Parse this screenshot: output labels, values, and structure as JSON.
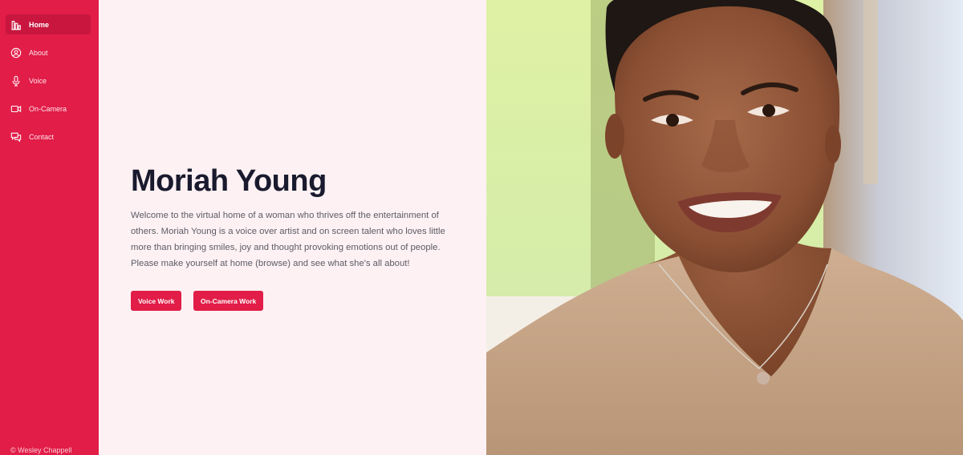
{
  "sidebar": {
    "items": [
      {
        "label": "Home",
        "icon": "home-chart-icon",
        "active": true
      },
      {
        "label": "About",
        "icon": "user-circle-icon",
        "active": false
      },
      {
        "label": "Voice",
        "icon": "microphone-icon",
        "active": false
      },
      {
        "label": "On-Camera",
        "icon": "video-camera-icon",
        "active": false
      },
      {
        "label": "Contact",
        "icon": "chat-bubbles-icon",
        "active": false
      }
    ],
    "footer": "© Wesley Chappell"
  },
  "main": {
    "title": "Moriah Young",
    "intro": "Welcome to the virtual home of a woman who thrives off the entertainment of others. Moriah Young is a voice over artist and on screen talent who loves little more than bringing smiles, joy and thought provoking emotions out of people. Please make yourself at home (browse) and see what she's all about!",
    "buttons": {
      "voice": "Voice Work",
      "camera": "On-Camera Work"
    }
  },
  "colors": {
    "accent": "#e11d48",
    "background": "#fdf1f3",
    "heading": "#1a1a2e",
    "body_text": "#5b5b66"
  }
}
